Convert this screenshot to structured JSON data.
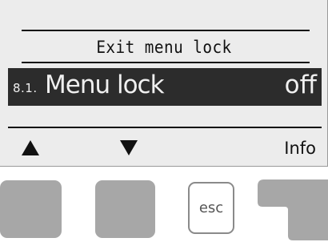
{
  "display": {
    "header": "Exit menu lock",
    "selected_row": {
      "number": "8.1.",
      "label": "Menu lock",
      "value": "off"
    },
    "softkeys": {
      "up_icon": "arrow-up-icon",
      "down_icon": "arrow-down-icon",
      "info_label": "Info"
    }
  },
  "hardware_buttons": {
    "esc_label": "esc"
  },
  "colors": {
    "lcd_background": "#ececec",
    "highlight_background": "#2c2c2c",
    "button_gray": "#a7a7a7"
  }
}
